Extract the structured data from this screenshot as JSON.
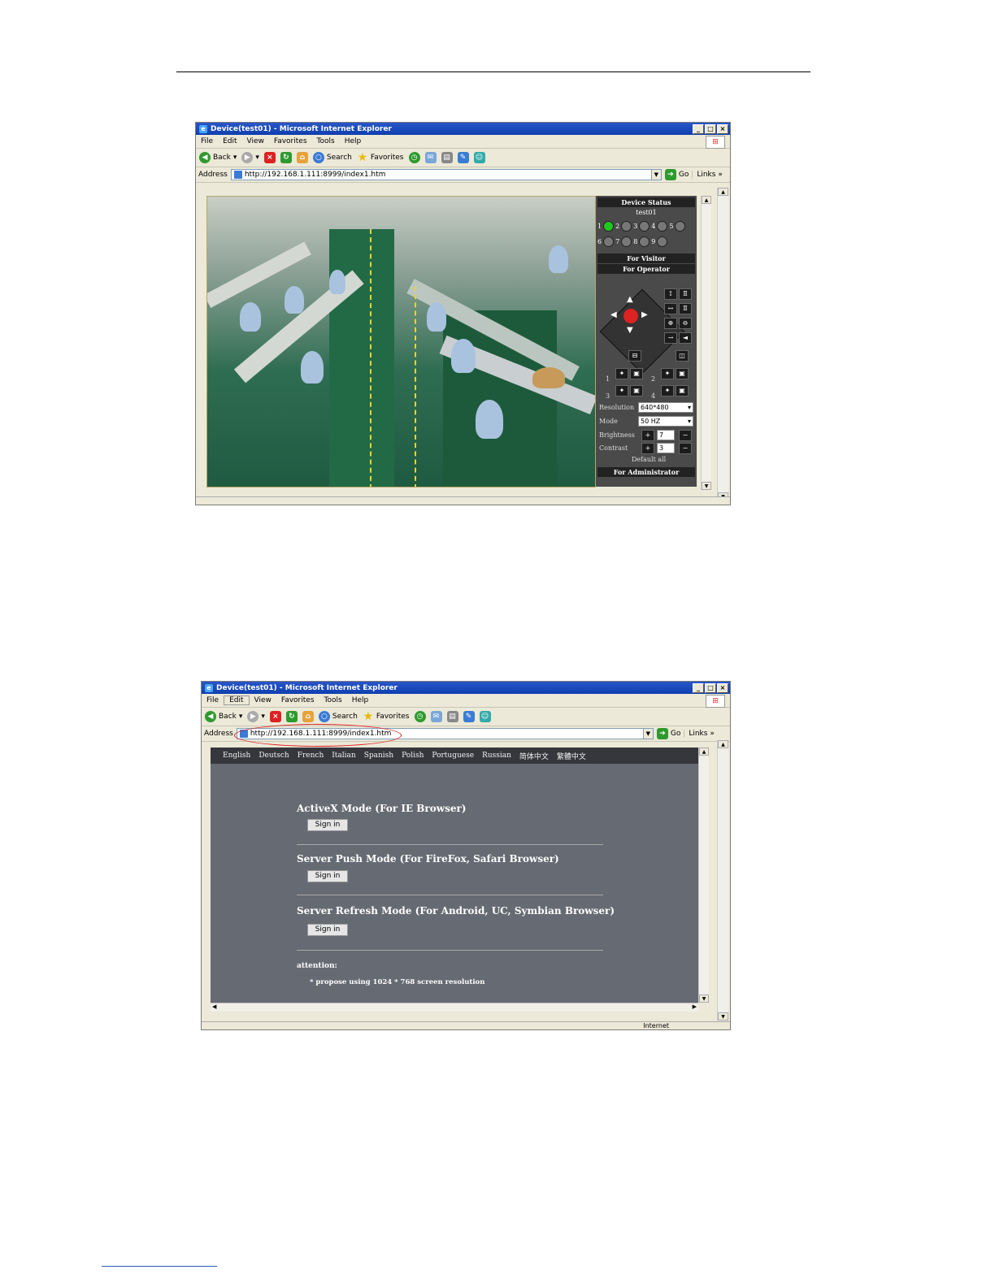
{
  "shot1": {
    "window_title": "Device(test01) - Microsoft Internet Explorer",
    "menu": [
      "File",
      "Edit",
      "View",
      "Favorites",
      "Tools",
      "Help"
    ],
    "toolbar": {
      "back": "Back",
      "search": "Search",
      "favorites": "Favorites"
    },
    "address_label": "Address",
    "url": "http://192.168.1.111:8999/index1.htm",
    "go": "Go",
    "links": "Links",
    "panel": {
      "device_status": "Device Status",
      "device_name": "test01",
      "led_row1": [
        "1",
        "2",
        "3",
        "4",
        "5"
      ],
      "led_row2": [
        "6",
        "7",
        "8",
        "9"
      ],
      "for_visitor": "For Visitor",
      "for_operator": "For Operator",
      "preset1": "1",
      "preset2": "2",
      "preset3": "3",
      "preset4": "4",
      "resolution_label": "Resolution",
      "resolution_value": "640*480",
      "mode_label": "Mode",
      "mode_value": "50 HZ",
      "brightness_label": "Brightness",
      "brightness_value": "7",
      "contrast_label": "Contrast",
      "contrast_value": "3",
      "default_all": "Default all",
      "for_administrator": "For Administrator"
    }
  },
  "shot2": {
    "window_title": "Device(test01) - Microsoft Internet Explorer",
    "menu": [
      "File",
      "Edit",
      "View",
      "Favorites",
      "Tools",
      "Help"
    ],
    "toolbar": {
      "back": "Back",
      "search": "Search",
      "favorites": "Favorites"
    },
    "address_label": "Address",
    "url": "http://192.168.1.111:8999/index1.htm",
    "go": "Go",
    "links": "Links",
    "languages": [
      "English",
      "Deutsch",
      "French",
      "Italian",
      "Spanish",
      "Polish",
      "Portuguese",
      "Russian",
      "简体中文",
      "繁體中文"
    ],
    "modes": [
      {
        "title": "ActiveX Mode (For IE Browser)",
        "button": "Sign in"
      },
      {
        "title": "Server Push Mode (For FireFox, Safari Browser)",
        "button": "Sign in"
      },
      {
        "title": "Server Refresh Mode (For Android, UC, Symbian Browser)",
        "button": "Sign in"
      }
    ],
    "attention_label": "attention:",
    "attention_note": "* propose using 1024 * 768 screen resolution",
    "status_zone": "Internet"
  }
}
